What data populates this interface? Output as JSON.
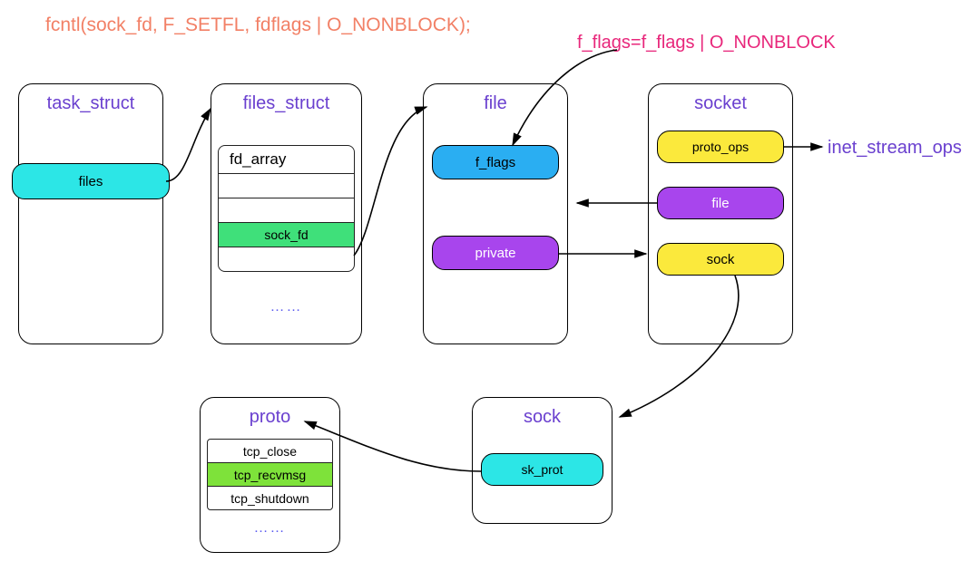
{
  "code_line": "fcntl(sock_fd, F_SETFL, fdflags | O_NONBLOCK);",
  "annot": "f_flags=f_flags | O_NONBLOCK",
  "right_label": "inet_stream_ops",
  "colors": {
    "code_orange": "#f28066",
    "annot_pink": "#e8277b",
    "purple_text": "#6a40cf",
    "cyan": "#2ce6e6",
    "green": "#3fe07a",
    "blue": "#2aaef2",
    "purple": "#a845ed",
    "yellow": "#fbe93c",
    "lime": "#7ee23a"
  },
  "boxes": {
    "task_struct": {
      "title": "task_struct",
      "field": "files"
    },
    "files_struct": {
      "title": "files_struct",
      "table_header": "fd_array",
      "rows": [
        "",
        "",
        "sock_fd",
        ""
      ],
      "highlight_index": 2,
      "ellipsis": "……"
    },
    "file": {
      "title": "file",
      "f1": "f_flags",
      "f2": "private"
    },
    "socket": {
      "title": "socket",
      "f1": "proto_ops",
      "f2": "file",
      "f3": "sock"
    },
    "sock": {
      "title": "sock",
      "f1": "sk_prot"
    },
    "proto": {
      "title": "proto",
      "rows": [
        "tcp_close",
        "tcp_recvmsg",
        "tcp_shutdown"
      ],
      "highlight_index": 1,
      "ellipsis": "……"
    }
  }
}
